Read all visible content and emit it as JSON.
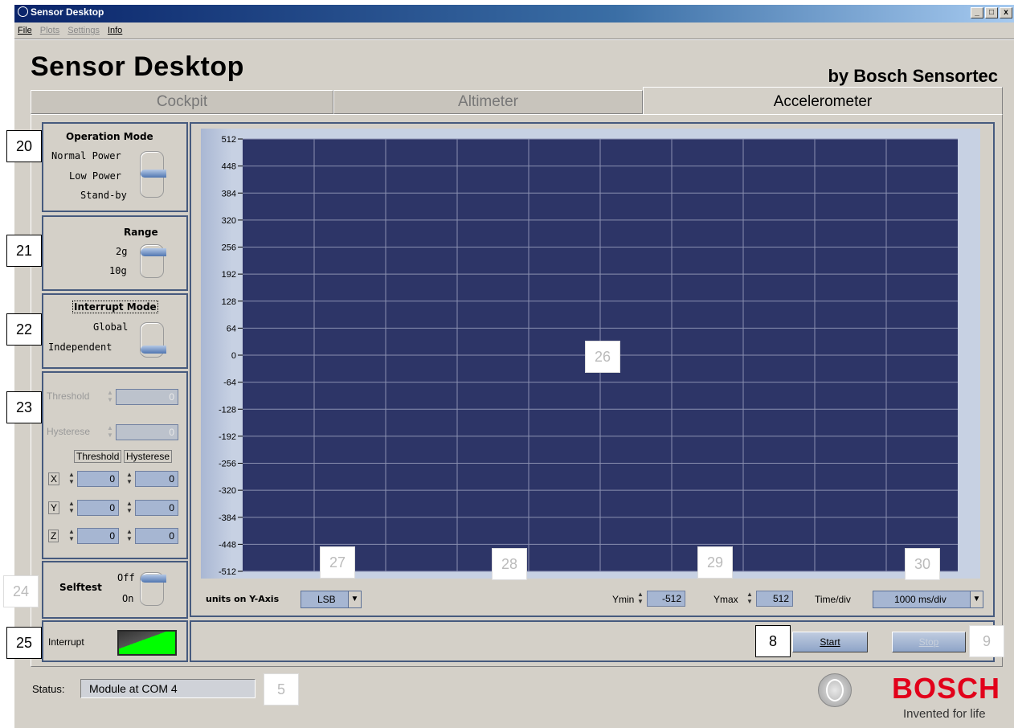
{
  "window": {
    "title": "Sensor Desktop",
    "buttons": [
      "_",
      "□",
      "x"
    ]
  },
  "menu": [
    {
      "label": "File",
      "enabled": true
    },
    {
      "label": "Plots",
      "enabled": false
    },
    {
      "label": "Settings",
      "enabled": false
    },
    {
      "label": "Info",
      "enabled": true
    }
  ],
  "header": {
    "title": "Sensor Desktop",
    "subtitle": "by Bosch Sensortec"
  },
  "tabs": [
    {
      "label": "Cockpit"
    },
    {
      "label": "Altimeter"
    },
    {
      "label": "Accelerometer"
    }
  ],
  "operation_mode": {
    "title": "Operation Mode",
    "options": [
      "Normal Power",
      "Low Power",
      "Stand-by"
    ],
    "selected": "Low Power"
  },
  "range": {
    "title": "Range",
    "options": [
      "2g",
      "10g"
    ],
    "selected": "2g"
  },
  "interrupt_mode": {
    "title": "Interrupt Mode",
    "options": [
      "Global",
      "Independent"
    ],
    "selected": "Independent"
  },
  "thresholds": {
    "threshold_label": "Threshold",
    "threshold_value": "0",
    "hysterese_label": "Hysterese",
    "hysterese_value": "0",
    "col_threshold": "Threshold",
    "col_hysterese": "Hysterese",
    "axes": [
      {
        "axis": "X",
        "threshold": "0",
        "hysterese": "0"
      },
      {
        "axis": "Y",
        "threshold": "0",
        "hysterese": "0"
      },
      {
        "axis": "Z",
        "threshold": "0",
        "hysterese": "0"
      }
    ]
  },
  "selftest": {
    "title": "Selftest",
    "options": [
      "Off",
      "On"
    ],
    "selected": "Off"
  },
  "interrupt": {
    "label": "Interrupt"
  },
  "plot": {
    "units_label": "units on Y-Axis",
    "units_value": "LSB",
    "ymin_label": "Ymin",
    "ymin_value": "-512",
    "ymax_label": "Ymax",
    "ymax_value": "512",
    "timediv_label": "Time/div",
    "timediv_value": "1000 ms/div"
  },
  "chart_data": {
    "type": "line",
    "series": [],
    "y_ticks": [
      "512",
      "448",
      "384",
      "320",
      "256",
      "192",
      "128",
      "64",
      "0",
      "-64",
      "-128",
      "-192",
      "-256",
      "-320",
      "-384",
      "-448",
      "-512"
    ],
    "ylim": [
      -512,
      512
    ],
    "grid": true,
    "background": "#2d3567"
  },
  "buttons": {
    "start": "Start",
    "stop": "Stop"
  },
  "status": {
    "label": "Status:",
    "value": "Module at COM 4"
  },
  "callouts": {
    "c20": "20",
    "c21": "21",
    "c22": "22",
    "c23": "23",
    "c24": "24",
    "c25": "25",
    "c26": "26",
    "c27": "27",
    "c28": "28",
    "c29": "29",
    "c30": "30",
    "c5": "5",
    "c8": "8",
    "c9": "9"
  },
  "brand": {
    "name": "BOSCH",
    "tagline": "Invented for life",
    "color": "#e2001a"
  }
}
